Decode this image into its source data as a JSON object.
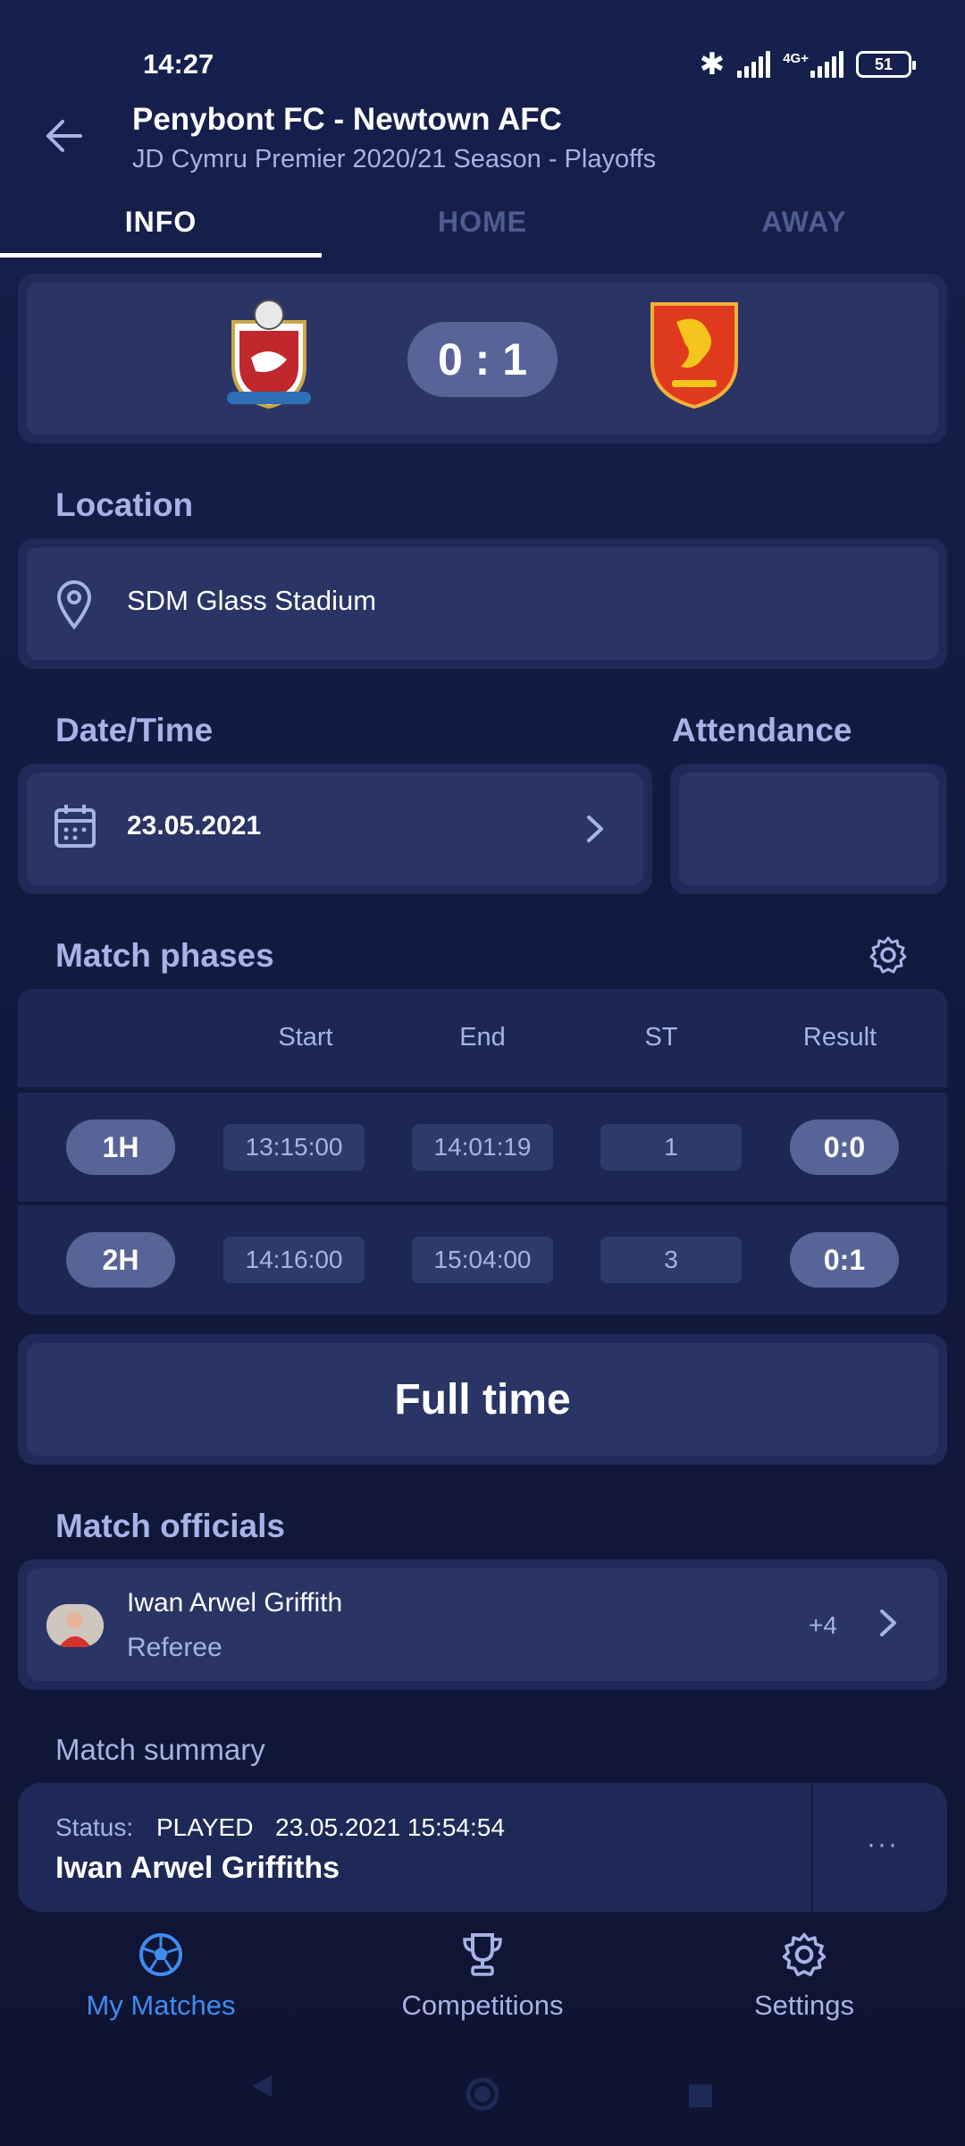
{
  "status_bar": {
    "time": "14:27",
    "network": "4G+",
    "battery": "51"
  },
  "header": {
    "title": "Penybont FC - Newtown AFC",
    "subtitle": "JD Cymru Premier 2020/21 Season - Playoffs"
  },
  "tabs": [
    {
      "label": "INFO",
      "active": true
    },
    {
      "label": "HOME",
      "active": false
    },
    {
      "label": "AWAY",
      "active": false
    }
  ],
  "score": {
    "display": "0 : 1"
  },
  "location": {
    "label": "Location",
    "value": "SDM Glass Stadium"
  },
  "date_time": {
    "label": "Date/Time",
    "value": "23.05.2021"
  },
  "attendance": {
    "label": "Attendance",
    "value": ""
  },
  "match_phases": {
    "label": "Match phases",
    "columns": [
      "Start",
      "End",
      "ST",
      "Result"
    ],
    "rows": [
      {
        "phase": "1H",
        "start": "13:15:00",
        "end": "14:01:19",
        "st": "1",
        "result": "0:0"
      },
      {
        "phase": "2H",
        "start": "14:16:00",
        "end": "15:04:00",
        "st": "3",
        "result": "0:1"
      }
    ]
  },
  "full_time": {
    "label": "Full time"
  },
  "officials": {
    "label": "Match officials",
    "name": "Iwan Arwel Griffith",
    "role": "Referee",
    "more": "+4"
  },
  "summary": {
    "label": "Match summary",
    "status_label": "Status:",
    "status_value": "PLAYED",
    "datetime": "23.05.2021 15:54:54",
    "name": "Iwan Arwel Griffiths",
    "more": "···"
  },
  "bottom_nav": [
    {
      "label": "My Matches",
      "active": true,
      "icon": "soccer-ball-icon"
    },
    {
      "label": "Competitions",
      "active": false,
      "icon": "trophy-icon"
    },
    {
      "label": "Settings",
      "active": false,
      "icon": "gear-icon"
    }
  ],
  "colors": {
    "accent": "#3e8cf0",
    "muted": "#a7b3e6",
    "card": "#2a3566"
  }
}
